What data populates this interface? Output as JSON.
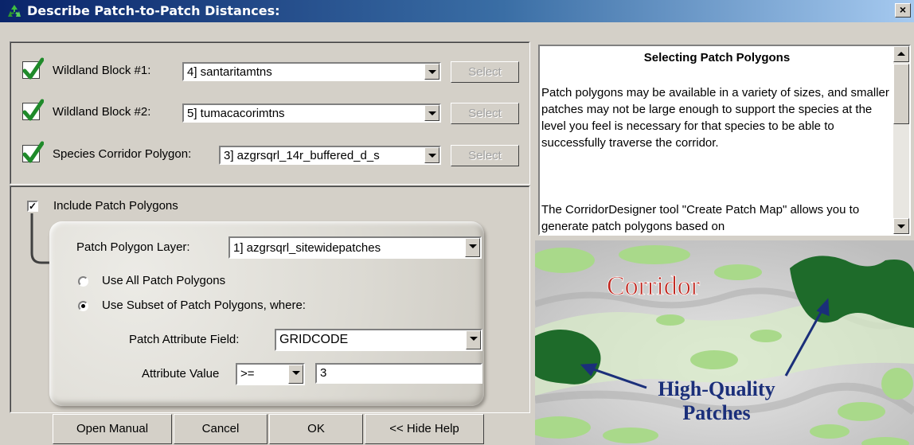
{
  "window": {
    "title": "Describe Patch-to-Patch Distances:",
    "close_glyph": "×"
  },
  "blocks": [
    {
      "label": "Wildland Block #1:",
      "value": "4] santaritamtns",
      "button": "Select"
    },
    {
      "label": "Wildland Block #2:",
      "value": "5] tumacacorimtns",
      "button": "Select"
    },
    {
      "label": "Species Corridor Polygon:",
      "value": "3] azgrsqrl_14r_buffered_d_s",
      "button": "Select"
    }
  ],
  "patch": {
    "include_label": "Include Patch Polygons",
    "include_checked": true,
    "layer_label": "Patch Polygon Layer:",
    "layer_value": "1] azgrsqrl_sitewidepatches",
    "radio_all": "Use All Patch Polygons",
    "radio_subset": "Use Subset of Patch Polygons, where:",
    "selected_option": "subset",
    "field_label": "Patch Attribute Field:",
    "field_value": "GRIDCODE",
    "value_label": "Attribute Value",
    "operator": ">=",
    "attr_value": "3"
  },
  "buttons": {
    "manual": "Open Manual",
    "cancel": "Cancel",
    "ok": "OK",
    "help": "<< Hide Help"
  },
  "help": {
    "title": "Selecting Patch Polygons",
    "para1": "Patch polygons may be available in a variety of sizes, and smaller patches may not be large enough to support the species at the level you feel is necessary for that species to be able to successfully traverse the corridor.",
    "para2": "The CorridorDesigner tool \"Create Patch Map\" allows you to generate patch polygons based on"
  },
  "map": {
    "label_corridor": "Corridor",
    "label_hq_1": "High-Quality",
    "label_hq_2": "Patches"
  },
  "colors": {
    "check_green": "#1f8a2a",
    "dark_patch": "#1e6b2a",
    "light_patch": "#a9d98a",
    "corridor_text": "#c0241c",
    "hq_text": "#1b2f7a"
  },
  "icons": {
    "title": "recycle-icon",
    "check": "checkmark-icon",
    "dropdown": "chevron-down-icon"
  }
}
